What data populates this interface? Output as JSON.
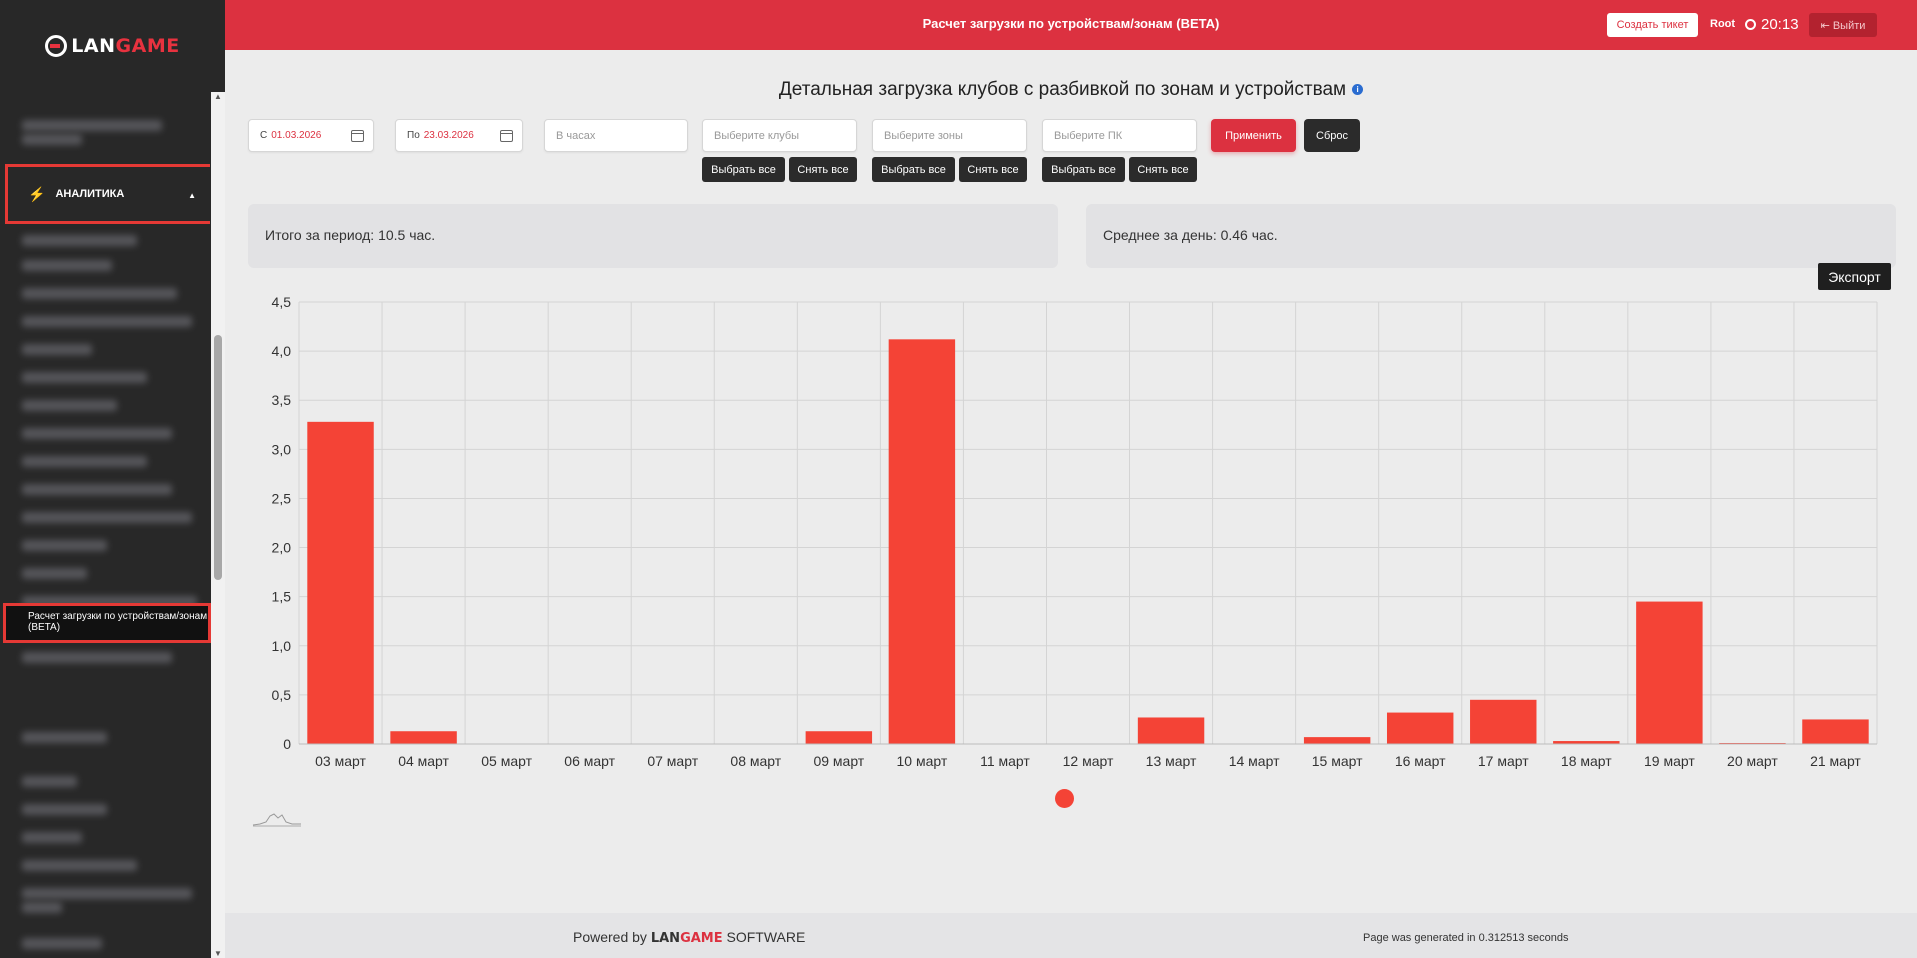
{
  "sidebar": {
    "logo_prefix": "LAN",
    "logo_suffix": "GAME",
    "analytics_label": "АНАЛИТИКА",
    "active_item_label": "Расчет загрузки по устройствам/зонам (BETA)"
  },
  "topbar": {
    "title": "Расчет загрузки по устройствам/зонам (BETA)",
    "create_ticket_label": "Создать тикет",
    "user": "Root",
    "time": "20:13",
    "logout_label": "Выйти"
  },
  "page": {
    "title": "Детальная загрузка клубов с разбивкой по зонам и устройствам"
  },
  "filters": {
    "date_from_label": "С",
    "date_from_value": "01.03.2026",
    "date_to_label": "По",
    "date_to_value": "23.03.2026",
    "hours_placeholder": "В часах",
    "clubs_placeholder": "Выберите клубы",
    "zones_placeholder": "Выберите зоны",
    "pc_placeholder": "Выберите ПК",
    "select_all_label": "Выбрать все",
    "clear_all_label": "Снять все",
    "apply_label": "Применить",
    "reset_label": "Сброс"
  },
  "summary": {
    "total": "Итого за период: 10.5 час.",
    "average": "Среднее за день: 0.46 час."
  },
  "export_label": "Экспорт",
  "chart_data": {
    "type": "bar",
    "categories": [
      "03 март",
      "04 март",
      "05 март",
      "06 март",
      "07 март",
      "08 март",
      "09 март",
      "10 март",
      "11 март",
      "12 март",
      "13 март",
      "14 март",
      "15 март",
      "16 март",
      "17 март",
      "18 март",
      "19 март",
      "20 март",
      "21 март"
    ],
    "values": [
      3.28,
      0.13,
      0,
      0,
      0,
      0,
      0.13,
      4.12,
      0,
      0,
      0.27,
      0,
      0.07,
      0.32,
      0.45,
      0.03,
      1.45,
      0.01,
      0.25
    ],
    "yticks": [
      "0",
      "0,5",
      "1,0",
      "1,5",
      "2,0",
      "2,5",
      "3,0",
      "3,5",
      "4,0",
      "4,5"
    ],
    "ylim": [
      0,
      4.5
    ],
    "grid": true,
    "bar_color": "#f44336"
  },
  "footer": {
    "powered_prefix": "Powered by",
    "powered_brand_a": "LAN",
    "powered_brand_b": "GAME",
    "powered_suffix": "SOFTWARE",
    "generated": "Page was generated in 0.312513 seconds"
  },
  "colors": {
    "accent": "#dc3140",
    "sidebar_bg": "#282828",
    "bar": "#f44336"
  }
}
